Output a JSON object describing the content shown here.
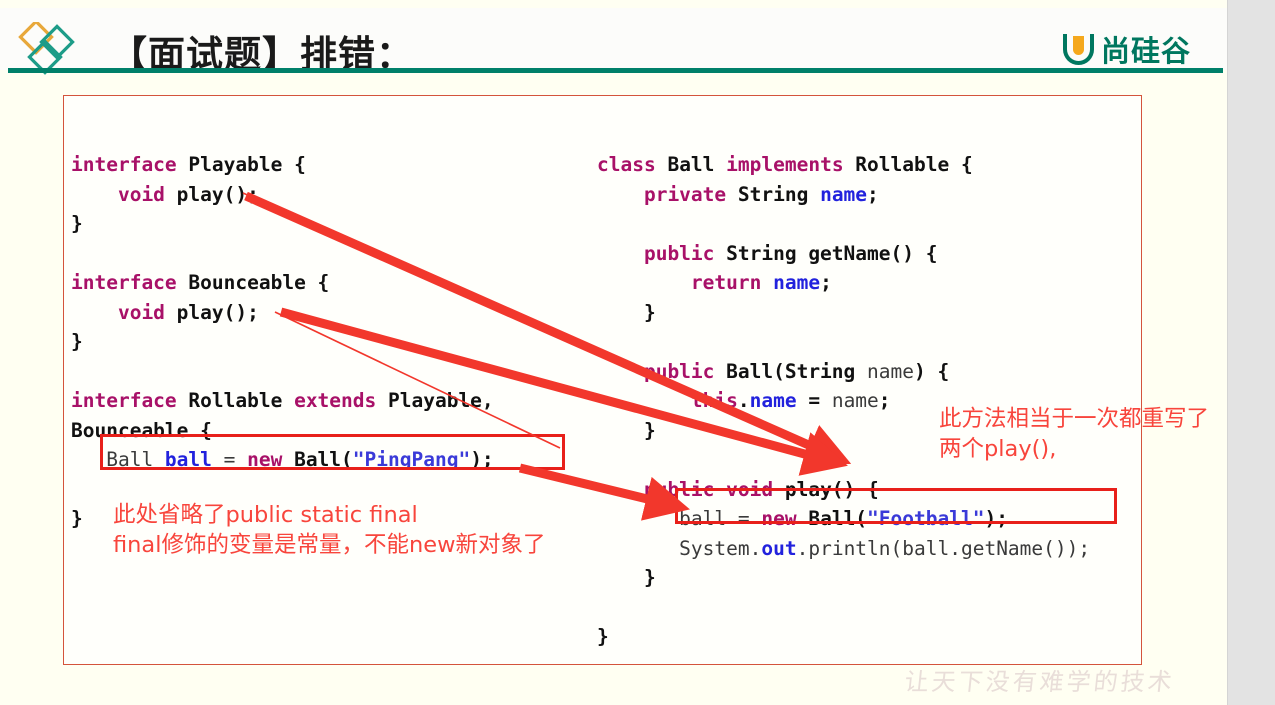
{
  "slide": {
    "title": "【面试题】排错：",
    "brand_name": "尚硅谷",
    "brand_mark": "u-logo-icon",
    "logo": "diamonds-logo-icon",
    "watermark": "让天下没有难学的技术",
    "accent_green": "#00806a",
    "accent_red": "#e8201a",
    "annotation_red": "#f8453c",
    "panel_border": "#d4543c",
    "background": "#fffff2"
  },
  "code_left": {
    "lines": [
      [
        {
          "t": "interface ",
          "c": "kw"
        },
        {
          "t": "Playable {",
          "c": "id"
        }
      ],
      [
        {
          "t": "    void ",
          "c": "kw"
        },
        {
          "t": "play();",
          "c": "id"
        }
      ],
      [
        {
          "t": "}",
          "c": "id"
        }
      ],
      [
        {
          "t": "",
          "c": "id"
        }
      ],
      [
        {
          "t": "interface ",
          "c": "kw"
        },
        {
          "t": "Bounceable {",
          "c": "id"
        }
      ],
      [
        {
          "t": "    void ",
          "c": "kw"
        },
        {
          "t": "play();",
          "c": "id"
        }
      ],
      [
        {
          "t": "}",
          "c": "id"
        }
      ],
      [
        {
          "t": "",
          "c": "id"
        }
      ],
      [
        {
          "t": "interface ",
          "c": "kw"
        },
        {
          "t": "Rollable ",
          "c": "id"
        },
        {
          "t": "extends ",
          "c": "kw"
        },
        {
          "t": "Playable,",
          "c": "id"
        }
      ],
      [
        {
          "t": "Bounceable {",
          "c": "id"
        }
      ],
      [
        {
          "t": "   Ball ",
          "c": "plain"
        },
        {
          "t": "ball ",
          "c": "fld"
        },
        {
          "t": "= ",
          "c": "plain"
        },
        {
          "t": "new ",
          "c": "kw"
        },
        {
          "t": "Ball(",
          "c": "id"
        },
        {
          "t": "\"PingPang\"",
          "c": "str"
        },
        {
          "t": ");",
          "c": "id"
        }
      ],
      [
        {
          "t": "",
          "c": "id"
        }
      ],
      [
        {
          "t": "}",
          "c": "id"
        }
      ]
    ]
  },
  "code_right": {
    "lines": [
      [
        {
          "t": "class ",
          "c": "kw"
        },
        {
          "t": "Ball ",
          "c": "id"
        },
        {
          "t": "implements ",
          "c": "kw"
        },
        {
          "t": "Rollable {",
          "c": "id"
        }
      ],
      [
        {
          "t": "    private ",
          "c": "kw"
        },
        {
          "t": "String ",
          "c": "id"
        },
        {
          "t": "name",
          "c": "fld"
        },
        {
          "t": ";",
          "c": "id"
        }
      ],
      [
        {
          "t": "",
          "c": "id"
        }
      ],
      [
        {
          "t": "    public ",
          "c": "kw"
        },
        {
          "t": "String getName() {",
          "c": "id"
        }
      ],
      [
        {
          "t": "        return ",
          "c": "kw"
        },
        {
          "t": "name",
          "c": "fld"
        },
        {
          "t": ";",
          "c": "id"
        }
      ],
      [
        {
          "t": "    }",
          "c": "id"
        }
      ],
      [
        {
          "t": "",
          "c": "id"
        }
      ],
      [
        {
          "t": "    public ",
          "c": "kw"
        },
        {
          "t": "Ball(String ",
          "c": "id"
        },
        {
          "t": "name",
          "c": "plain"
        },
        {
          "t": ") {",
          "c": "id"
        }
      ],
      [
        {
          "t": "        this",
          "c": "kw"
        },
        {
          "t": ".",
          "c": "id"
        },
        {
          "t": "name ",
          "c": "fld"
        },
        {
          "t": "= ",
          "c": "id"
        },
        {
          "t": "name",
          "c": "plain"
        },
        {
          "t": ";",
          "c": "id"
        }
      ],
      [
        {
          "t": "    }",
          "c": "id"
        }
      ],
      [
        {
          "t": "",
          "c": "id"
        }
      ],
      [
        {
          "t": "    public void ",
          "c": "kw"
        },
        {
          "t": "play() {",
          "c": "id"
        }
      ],
      [
        {
          "t": "       ball ",
          "c": "plain"
        },
        {
          "t": "= ",
          "c": "plain"
        },
        {
          "t": "new ",
          "c": "kw"
        },
        {
          "t": "Ball(",
          "c": "id"
        },
        {
          "t": "\"Football\"",
          "c": "str"
        },
        {
          "t": ");",
          "c": "id"
        }
      ],
      [
        {
          "t": "       System.",
          "c": "plain"
        },
        {
          "t": "out",
          "c": "fld"
        },
        {
          "t": ".println(ball.getName());",
          "c": "plain"
        }
      ],
      [
        {
          "t": "    }",
          "c": "id"
        }
      ],
      [
        {
          "t": "",
          "c": "id"
        }
      ],
      [
        {
          "t": "}",
          "c": "id"
        }
      ]
    ]
  },
  "annotations": {
    "left": "此处省略了public static final\nfinal修饰的变量是常量，不能new新对象了",
    "right": "此方法相当于一次都重写了\n两个play(),"
  },
  "highlight_boxes": [
    {
      "name": "pingpang-highlight",
      "label": "Ball ball = new Ball(\"PingPang\");"
    },
    {
      "name": "football-highlight",
      "label": "ball = new Ball(\"Football\");"
    }
  ],
  "arrows": [
    {
      "name": "arrow-playable-to-play",
      "from": "void play(); (Playable)",
      "to": "public void play()"
    },
    {
      "name": "arrow-bounceable-to-play",
      "from": "void play(); (Bounceable)",
      "to": "public void play()"
    },
    {
      "name": "arrow-pingpang-to-football",
      "from": "\"PingPang\" declaration",
      "to": "ball = new Ball(\"Football\");"
    }
  ]
}
